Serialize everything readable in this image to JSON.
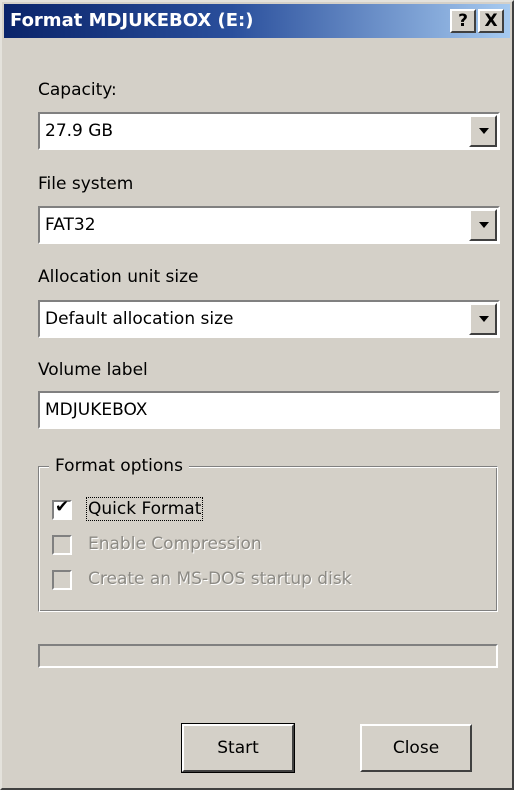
{
  "window": {
    "title": "Format MDJUKEBOX (E:)",
    "help_button": "?",
    "close_button": "X"
  },
  "capacity": {
    "label": "Capacity:",
    "value": "27.9 GB"
  },
  "file_system": {
    "label": "File system",
    "value": "FAT32"
  },
  "allocation": {
    "label": "Allocation unit size",
    "value": "Default allocation size"
  },
  "volume_label": {
    "label": "Volume label",
    "value": "MDJUKEBOX"
  },
  "format_options": {
    "legend": "Format options",
    "quick_format": {
      "label": "Quick Format",
      "checked": true,
      "enabled": true
    },
    "enable_compression": {
      "label": "Enable Compression",
      "checked": false,
      "enabled": false
    },
    "msdos_startup": {
      "label": "Create an MS-DOS startup disk",
      "checked": false,
      "enabled": false
    }
  },
  "progress": {
    "value": 0
  },
  "buttons": {
    "start": "Start",
    "close": "Close"
  },
  "colors": {
    "face": "#d4d0c8",
    "title_start": "#0a246a",
    "title_end": "#a6caf0",
    "disabled_text": "#8c8a84"
  },
  "icons": {
    "help": "question-mark",
    "close": "x-mark",
    "dropdown": "down-triangle",
    "check": "check-mark"
  }
}
